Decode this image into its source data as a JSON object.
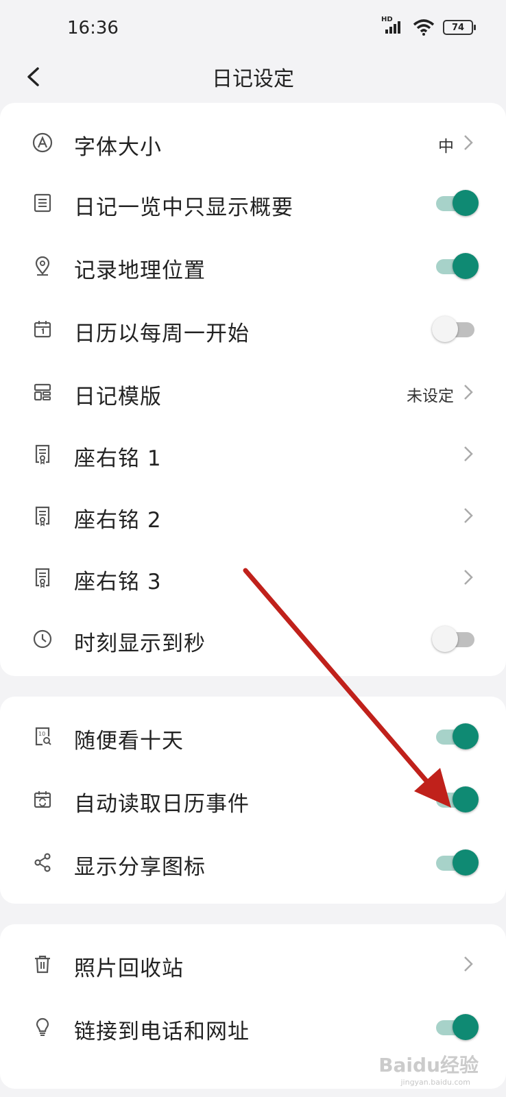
{
  "status_bar": {
    "time": "16:36",
    "network": "HD",
    "battery": "74"
  },
  "header": {
    "title": "日记设定"
  },
  "sections": [
    {
      "items": [
        {
          "label": "字体大小",
          "icon": "font-size-icon",
          "value": "中",
          "chevron": true
        },
        {
          "label": "日记一览中只显示概要",
          "icon": "list-icon",
          "toggle": true
        },
        {
          "label": "记录地理位置",
          "icon": "location-pin-icon",
          "toggle": true
        },
        {
          "label": "日历以每周一开始",
          "icon": "calendar-icon",
          "toggle": false
        },
        {
          "label": "日记模版",
          "icon": "template-icon",
          "value": "未设定",
          "chevron": true
        },
        {
          "label": "座右铭 1",
          "icon": "certificate-icon",
          "chevron": true
        },
        {
          "label": "座右铭 2",
          "icon": "certificate-icon",
          "chevron": true
        },
        {
          "label": "座右铭 3",
          "icon": "certificate-icon",
          "chevron": true
        },
        {
          "label": "时刻显示到秒",
          "icon": "clock-icon",
          "toggle": false
        }
      ]
    },
    {
      "items": [
        {
          "label": "随便看十天",
          "icon": "ten-days-icon",
          "toggle": true
        },
        {
          "label": "自动读取日历事件",
          "icon": "calendar-sync-icon",
          "toggle": true
        },
        {
          "label": "显示分享图标",
          "icon": "share-icon",
          "toggle": true
        }
      ]
    },
    {
      "items": [
        {
          "label": "照片回收站",
          "icon": "trash-icon",
          "chevron": true
        },
        {
          "label": "链接到电话和网址",
          "icon": "lightbulb-icon",
          "toggle": true
        }
      ]
    }
  ],
  "colors": {
    "accent": "#0f8a73",
    "accent_track": "#a7d2c9",
    "annotation_arrow": "#c0211b"
  },
  "watermark": {
    "text": "Baidu经验",
    "sub": "jingyan.baidu.com"
  }
}
